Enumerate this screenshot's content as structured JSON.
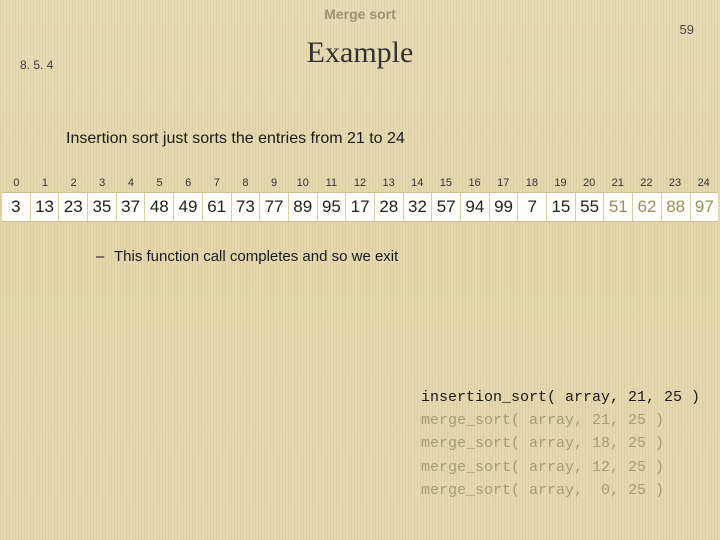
{
  "header": {
    "topic": "Merge sort",
    "page_number": "59",
    "section": "8. 5. 4",
    "title": "Example"
  },
  "body": {
    "statement": "Insertion sort just sorts the entries from 21 to 24",
    "bullet_dash": "–",
    "bullet_text": "This function call completes and so we exit"
  },
  "indices": [
    "0",
    "1",
    "2",
    "3",
    "4",
    "5",
    "6",
    "7",
    "8",
    "9",
    "10",
    "11",
    "12",
    "13",
    "14",
    "15",
    "16",
    "17",
    "18",
    "19",
    "20",
    "21",
    "22",
    "23",
    "24"
  ],
  "array": [
    "3",
    "13",
    "23",
    "35",
    "37",
    "48",
    "49",
    "61",
    "73",
    "77",
    "89",
    "95",
    "17",
    "28",
    "32",
    "57",
    "94",
    "99",
    "7",
    "15",
    "55",
    "51",
    "62",
    "88",
    "97"
  ],
  "highlight_start": 21,
  "highlight_end": 24,
  "call_stack": [
    {
      "text": "insertion_sort( array, 21, 25 )",
      "state": "active"
    },
    {
      "text": "merge_sort( array, 21, 25 )",
      "state": "faded"
    },
    {
      "text": "merge_sort( array, 18, 25 )",
      "state": "faded"
    },
    {
      "text": "merge_sort( array, 12, 25 )",
      "state": "faded"
    },
    {
      "text": "merge_sort( array,  0, 25 )",
      "state": "faded"
    }
  ]
}
